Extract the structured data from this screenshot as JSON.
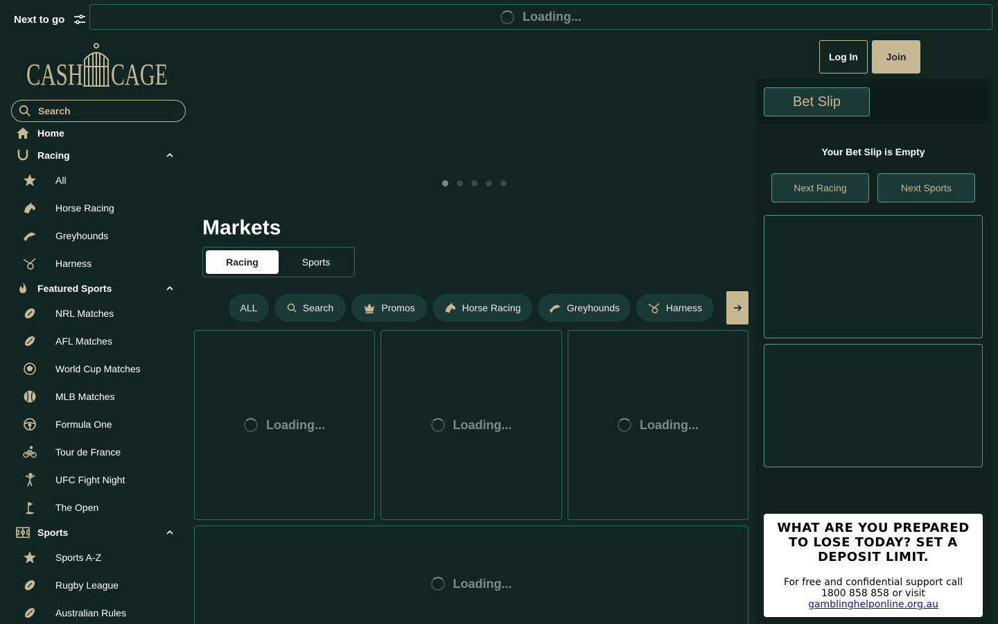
{
  "topbar": {
    "next_to_go": "Next to go",
    "loading": "Loading..."
  },
  "logo": {
    "left": "CASH",
    "right": "CAGE"
  },
  "search": {
    "placeholder": "Search"
  },
  "sidebar": {
    "home": "Home",
    "racing": {
      "label": "Racing",
      "items": [
        "All",
        "Horse Racing",
        "Greyhounds",
        "Harness"
      ]
    },
    "featured": {
      "label": "Featured Sports",
      "items": [
        "NRL Matches",
        "AFL Matches",
        "World Cup Matches",
        "MLB Matches",
        "Formula One",
        "Tour de France",
        "UFC Fight Night",
        "The Open"
      ]
    },
    "sports": {
      "label": "Sports",
      "items": [
        "Sports A-Z",
        "Rugby League",
        "Australian Rules"
      ]
    }
  },
  "auth": {
    "login": "Log In",
    "join": "Join"
  },
  "carousel": {
    "count": 5,
    "active": 0
  },
  "markets": {
    "title": "Markets",
    "tabs": [
      "Racing",
      "Sports"
    ],
    "active_tab": "Racing",
    "chips": [
      "ALL",
      "Search",
      "Promos",
      "Horse Racing",
      "Greyhounds",
      "Harness"
    ],
    "loading": "Loading..."
  },
  "betslip": {
    "tab": "Bet Slip",
    "empty": "Your Bet Slip is Empty",
    "next_racing": "Next Racing",
    "next_sports": "Next Sports"
  },
  "rg": {
    "heading": "WHAT ARE YOU PREPARED TO LOSE TODAY? SET A DEPOSIT LIMIT.",
    "body": "For free and confidential support call 1800 858 858 or visit",
    "link": "gamblinghelponline.org.au"
  },
  "colors": {
    "background": "#112622",
    "gold": "#c8b896",
    "border": "#2e6b5a",
    "chip": "#1c3a35"
  }
}
